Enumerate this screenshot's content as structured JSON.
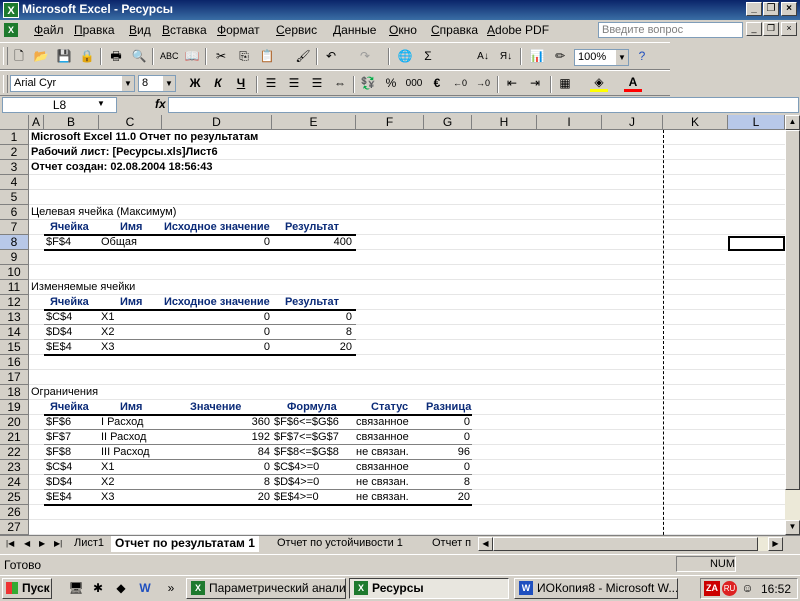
{
  "window": {
    "title": "Microsoft Excel - Ресурсы",
    "app_icon": "X"
  },
  "menu": [
    "Файл",
    "Правка",
    "Вид",
    "Вставка",
    "Формат",
    "Сервис",
    "Данные",
    "Окно",
    "Справка",
    "Adobe PDF"
  ],
  "help_placeholder": "Введите вопрос",
  "toolbar": {
    "zoom": "100%",
    "font": "Arial Cyr",
    "font_size": "8",
    "bold": "Ж",
    "italic": "К",
    "underline": "Ч",
    "percent": "%",
    "thousands": "000",
    "euro": "€"
  },
  "formula_bar": {
    "name_box": "L8",
    "fx": "fx",
    "value": ""
  },
  "columns": [
    "A",
    "B",
    "C",
    "D",
    "E",
    "F",
    "G",
    "H",
    "I",
    "J",
    "K",
    "L"
  ],
  "selected_column": "L",
  "selected_row": "8",
  "rows": [
    "1",
    "2",
    "3",
    "4",
    "5",
    "6",
    "7",
    "8",
    "9",
    "10",
    "11",
    "12",
    "13",
    "14",
    "15",
    "16",
    "17",
    "18",
    "19",
    "20",
    "21",
    "22",
    "23",
    "24",
    "25",
    "26",
    "27"
  ],
  "report": {
    "title": "Microsoft Excel 11.0 Отчет по результатам",
    "sheet": "Рабочий лист: [Ресурсы.xls]Лист6",
    "created": "Отчет создан: 02.08.2004 18:56:43",
    "target": {
      "caption": "Целевая ячейка (Максимум)",
      "headers": [
        "Ячейка",
        "Имя",
        "Исходное значение",
        "Результат"
      ],
      "rows": [
        [
          "$F$4",
          "Общая",
          "0",
          "400"
        ]
      ]
    },
    "variables": {
      "caption": "Изменяемые ячейки",
      "headers": [
        "Ячейка",
        "Имя",
        "Исходное значение",
        "Результат"
      ],
      "rows": [
        [
          "$C$4",
          "X1",
          "0",
          "0"
        ],
        [
          "$D$4",
          "X2",
          "0",
          "8"
        ],
        [
          "$E$4",
          "X3",
          "0",
          "20"
        ]
      ]
    },
    "constraints": {
      "caption": "Ограничения",
      "headers": [
        "Ячейка",
        "Имя",
        "Значение",
        "Формула",
        "Статус",
        "Разница"
      ],
      "rows": [
        [
          "$F$6",
          "I Расход",
          "360",
          "$F$6<=$G$6",
          "связанное",
          "0"
        ],
        [
          "$F$7",
          "II Расход",
          "192",
          "$F$7<=$G$7",
          "связанное",
          "0"
        ],
        [
          "$F$8",
          "III Расход",
          "84",
          "$F$8<=$G$8",
          "не связан.",
          "96"
        ],
        [
          "$C$4",
          "X1",
          "0",
          "$C$4>=0",
          "связанное",
          "0"
        ],
        [
          "$D$4",
          "X2",
          "8",
          "$D$4>=0",
          "не связан.",
          "8"
        ],
        [
          "$E$4",
          "X3",
          "20",
          "$E$4>=0",
          "не связан.",
          "20"
        ]
      ]
    }
  },
  "sheet_tabs": [
    "Лист1",
    "Отчет по результатам 1",
    "Отчет по устойчивости 1",
    "Отчет п"
  ],
  "active_tab": 1,
  "status": {
    "text": "Готово",
    "num": "NUM"
  },
  "taskbar": {
    "start": "Пуск",
    "tasks": [
      "Параметрический анализ",
      "Ресурсы",
      "ИОКопия8 - Microsoft W..."
    ],
    "active_task": 1,
    "clock": "16:52",
    "tray_badges": [
      "ZA",
      "RU"
    ]
  }
}
